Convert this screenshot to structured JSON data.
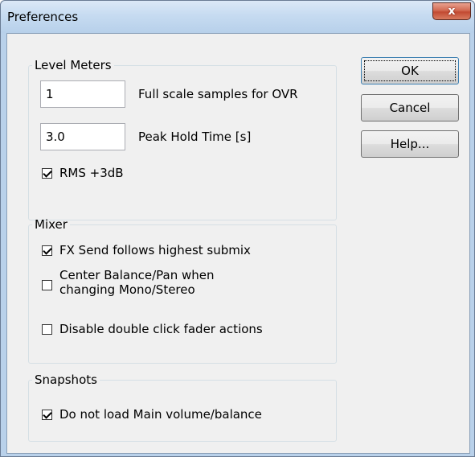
{
  "window": {
    "title": "Preferences",
    "close_glyph": "x"
  },
  "level_meters": {
    "legend": "Level Meters",
    "ovr_samples": {
      "value": "1",
      "label": "Full scale samples for OVR"
    },
    "peak_hold": {
      "value": "3.0",
      "label": "Peak Hold Time [s]"
    },
    "rms": {
      "label": "RMS +3dB",
      "checked": true
    }
  },
  "mixer": {
    "legend": "Mixer",
    "fx_send": {
      "label": "FX Send follows highest submix",
      "checked": true
    },
    "center_balance": {
      "label_line1": "Center Balance/Pan when",
      "label_line2": "changing Mono/Stereo",
      "checked": false
    },
    "disable_double_click": {
      "label": "Disable double click fader actions",
      "checked": false
    }
  },
  "snapshots": {
    "legend": "Snapshots",
    "no_load_main": {
      "label": "Do not load Main volume/balance",
      "checked": true
    }
  },
  "buttons": {
    "ok": "OK",
    "cancel": "Cancel",
    "help": "Help..."
  },
  "colors": {
    "titlebar": "#c6dbf1",
    "close": "#c24a32",
    "client": "#f0f0f0"
  }
}
